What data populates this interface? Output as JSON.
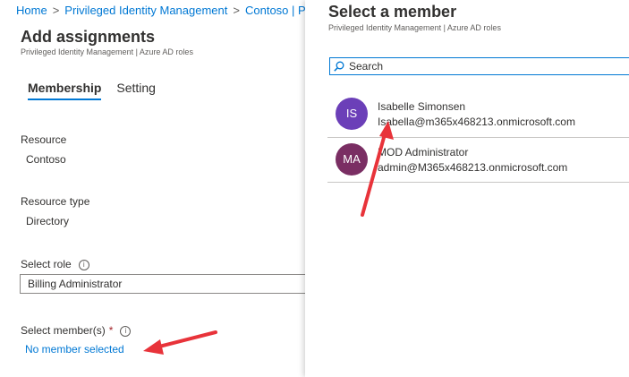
{
  "breadcrumb": {
    "items": [
      "Home",
      "Privileged Identity Management",
      "Contoso | P"
    ]
  },
  "page": {
    "title": "Add assignments",
    "subtitle": "Privileged Identity Management | Azure AD roles"
  },
  "tabs": [
    {
      "label": "Membership",
      "active": true
    },
    {
      "label": "Setting",
      "active": false
    }
  ],
  "fields": {
    "resource_label": "Resource",
    "resource_value": "Contoso",
    "resource_type_label": "Resource type",
    "resource_type_value": "Directory",
    "select_role_label": "Select role",
    "select_role_value": "Billing Administrator",
    "select_members_label": "Select member(s)",
    "required_marker": "*",
    "no_member_link": "No member selected"
  },
  "panel": {
    "title": "Select a member",
    "subtitle": "Privileged Identity Management | Azure AD roles",
    "search_placeholder": "Search",
    "members": [
      {
        "initials": "IS",
        "name": "Isabelle Simonsen",
        "email": "Isabella@m365x468213.onmicrosoft.com",
        "color": "#6b3fb8"
      },
      {
        "initials": "MA",
        "name": "MOD Administrator",
        "email": "admin@M365x468213.onmicrosoft.com",
        "color": "#7a2e63"
      }
    ]
  },
  "colors": {
    "accent": "#0078d4",
    "annotation_arrow": "#e8333a"
  }
}
